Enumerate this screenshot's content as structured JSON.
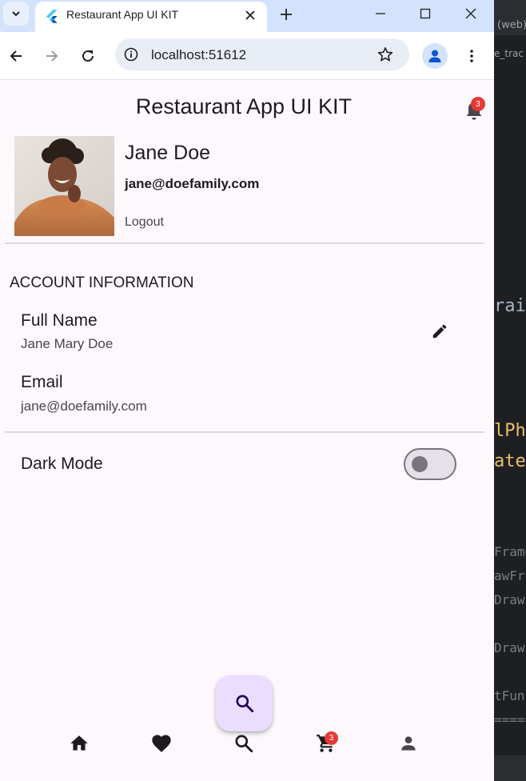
{
  "browser": {
    "tab_title": "Restaurant App UI KIT",
    "url": "localhost:51612"
  },
  "app": {
    "title": "Restaurant App UI KIT",
    "notification_count": "3",
    "cart_count": "3",
    "profile": {
      "name": "Jane Doe",
      "email": "jane@doefamily.com",
      "logout_label": "Logout"
    },
    "account_section": {
      "title": "ACCOUNT INFORMATION",
      "full_name_label": "Full Name",
      "full_name_value": "Jane Mary Doe",
      "email_label": "Email",
      "email_value": "jane@doefamily.com"
    },
    "dark_mode": {
      "label": "Dark Mode",
      "enabled": false
    },
    "bottom_nav": {
      "items": [
        "home-icon",
        "favorite-icon",
        "search-icon",
        "cart-icon",
        "profile-icon"
      ]
    }
  },
  "ide_background": {
    "tab_text": "(web)",
    "subtab_text": "e_trac",
    "code_fragments": [
      "rai",
      "lPh",
      "ate",
      "Frame",
      "awFr",
      "Draw",
      "Draw",
      "tFunc",
      "====="
    ]
  },
  "colors": {
    "app_background": "#fcf8fc",
    "fab_background": "#eaddff",
    "badge": "#e53935",
    "chrome_tabbar": "#d3e3fd"
  }
}
